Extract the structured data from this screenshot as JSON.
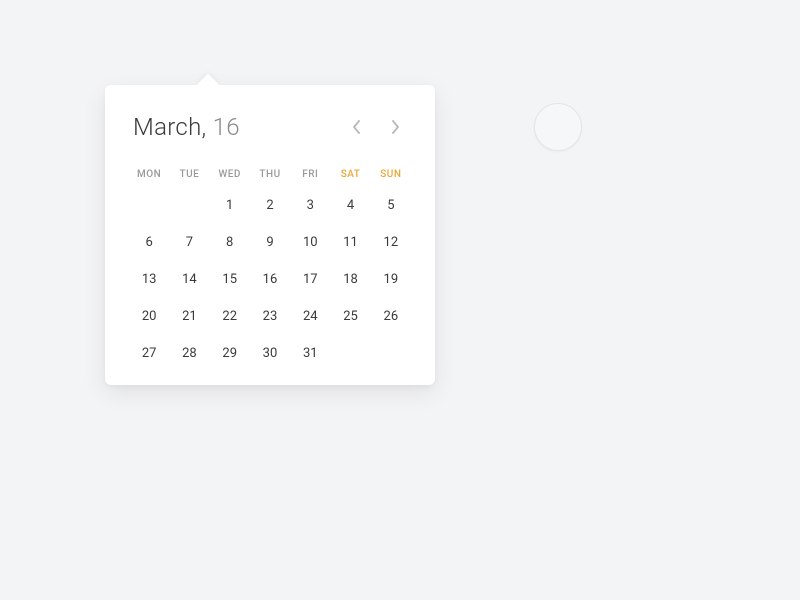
{
  "calendar": {
    "month": "March,",
    "year": "16",
    "dayHeaders": [
      "MON",
      "TUE",
      "WED",
      "THU",
      "FRI",
      "SAT",
      "SUN"
    ],
    "weekendIndices": [
      5,
      6
    ],
    "leadingEmpty": 2,
    "days": [
      "1",
      "2",
      "3",
      "4",
      "5",
      "6",
      "7",
      "8",
      "9",
      "10",
      "11",
      "12",
      "13",
      "14",
      "15",
      "16",
      "17",
      "18",
      "19",
      "20",
      "21",
      "22",
      "23",
      "24",
      "25",
      "26",
      "27",
      "28",
      "29",
      "30",
      "31"
    ]
  }
}
